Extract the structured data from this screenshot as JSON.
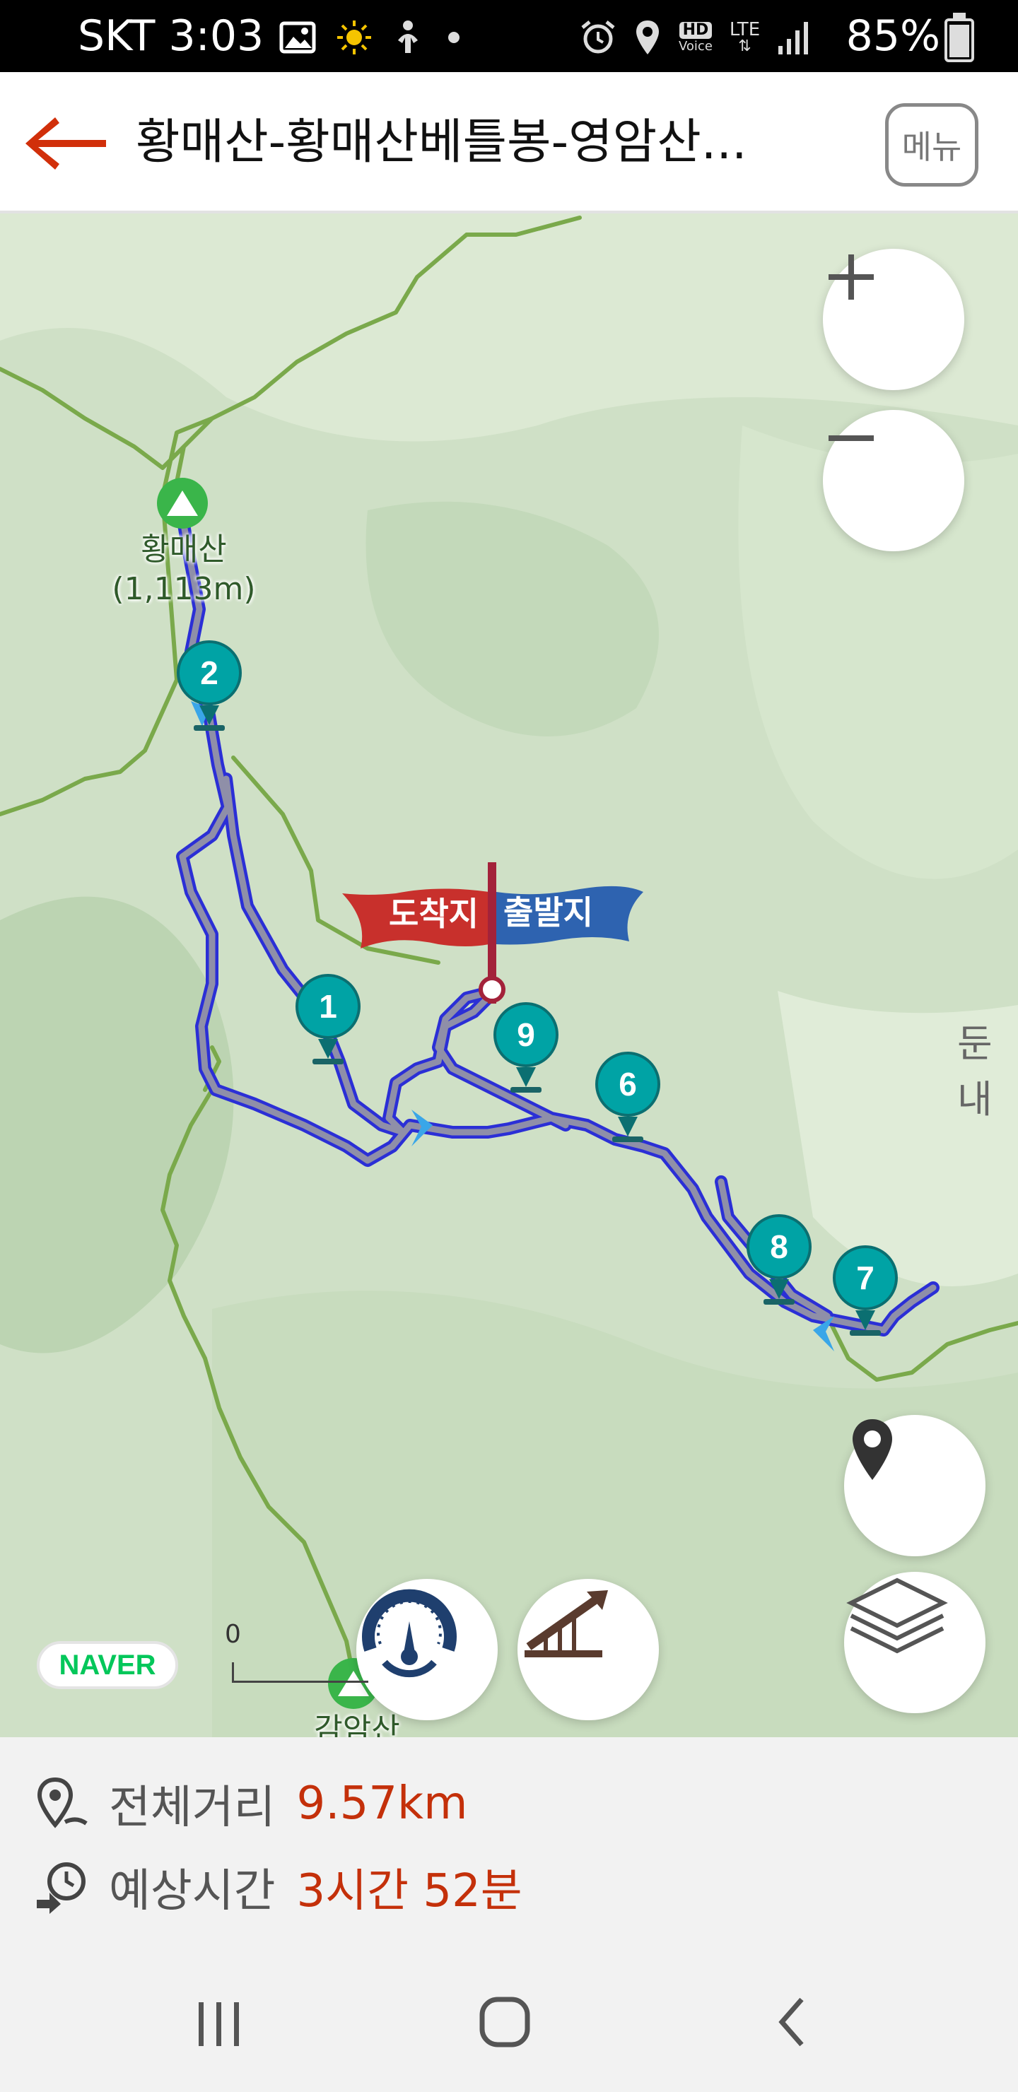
{
  "status_bar": {
    "carrier_time": "SKT 3:03",
    "battery": "85%",
    "battery_level": 0.85,
    "network": "LTE",
    "hd_voice": "HD",
    "hd_voice_sub": "Voice",
    "icons": [
      "image-icon",
      "sun-icon",
      "figure-icon",
      "dot-icon",
      "alarm-icon",
      "location-icon",
      "hd-voice-icon",
      "lte-icon",
      "signal-icon",
      "battery-icon"
    ]
  },
  "header": {
    "title": "황매산-황매산베틀봉-영암산...",
    "menu_label": "메뉴",
    "back_icon": "back-arrow-icon"
  },
  "map": {
    "places": [
      {
        "name": "황매산",
        "sub": "(1,113m)"
      },
      {
        "name": "감암산"
      },
      {
        "name": "둔내"
      }
    ],
    "flag": {
      "arrival": "도착지",
      "departure": "출발지"
    },
    "waypoints": [
      "2",
      "1",
      "9",
      "6",
      "8",
      "7"
    ],
    "logo": "NAVER",
    "scale_zero": "0",
    "controls": [
      "zoom-in-icon",
      "zoom-out-icon",
      "my-location-icon",
      "layers-icon",
      "speedometer-icon",
      "elevation-icon"
    ]
  },
  "info": {
    "distance_label": "전체거리",
    "distance_value": "9.57km",
    "time_label": "예상시간",
    "time_value": "3시간 52분"
  },
  "nav_bar": {
    "icons": [
      "recent-apps-icon",
      "home-icon",
      "back-icon"
    ]
  },
  "colors": {
    "accent": "#c4300a",
    "marker": "#00a3a5",
    "route": "#2b2fd6",
    "trail": "#7aa94b"
  }
}
